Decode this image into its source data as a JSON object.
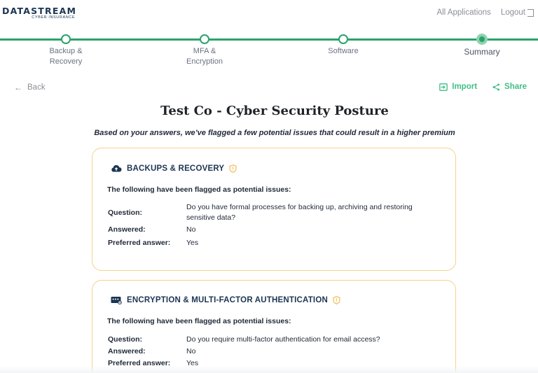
{
  "header": {
    "logo_main": "DATASTREAM",
    "logo_sub": "CYBER INSURANCE",
    "nav": {
      "all_applications": "All Applications",
      "logout": "Logout"
    }
  },
  "stepper": {
    "steps": [
      {
        "label": "Backup &\nRecovery",
        "state": "complete"
      },
      {
        "label": "MFA &\nEncryption",
        "state": "complete"
      },
      {
        "label": "Software",
        "state": "complete"
      },
      {
        "label": "Summary",
        "state": "current"
      }
    ],
    "accent_color": "#2aa36b"
  },
  "actions": {
    "back": "Back",
    "import": "Import",
    "share": "Share"
  },
  "page": {
    "title": "Test Co - Cyber Security Posture",
    "subtitle": "Based on your answers, we’ve flagged a few potential issues that could result in a higher premium"
  },
  "cards": [
    {
      "icon": "cloud-upload-icon",
      "title": "BACKUPS & RECOVERY",
      "flagged_text": "The following have been flagged as potential issues:",
      "labels": {
        "question": "Question:",
        "answered": "Answered:",
        "preferred": "Preferred answer:"
      },
      "question": "Do you have formal processes for backing up, archiving and restoring sensitive data?",
      "answered": "No",
      "preferred": "Yes"
    },
    {
      "icon": "id-card-icon",
      "title": "ENCRYPTION & MULTI-FACTOR AUTHENTICATION",
      "flagged_text": "The following have been flagged as potential issues:",
      "labels": {
        "question": "Question:",
        "answered": "Answered:",
        "preferred": "Preferred answer:"
      },
      "question": "Do you require multi-factor authentication for email access?",
      "answered": "No",
      "preferred": "Yes"
    }
  ],
  "colors": {
    "brand_navy": "#1b3552",
    "action_green": "#3fbf86",
    "card_border": "#f5d28a",
    "shield": "#f0b545"
  }
}
